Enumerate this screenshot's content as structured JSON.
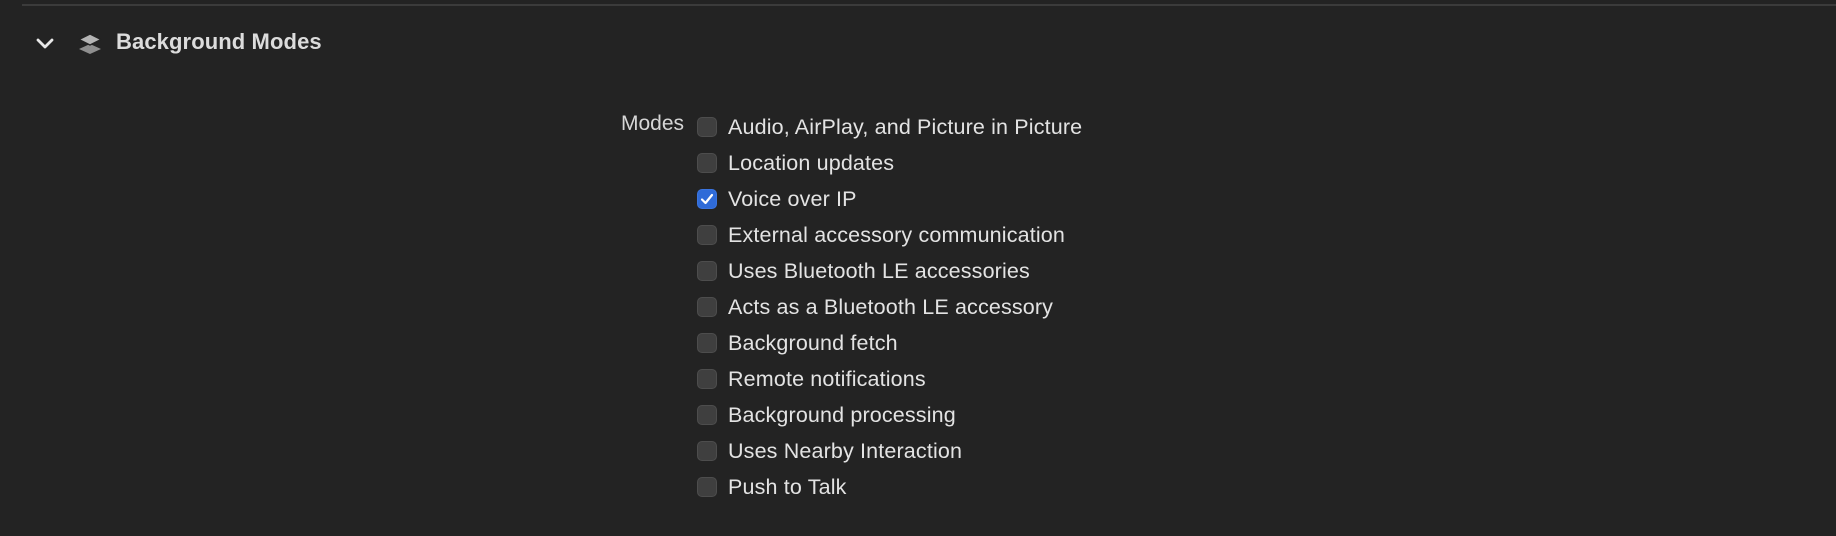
{
  "section": {
    "title": "Background Modes",
    "expanded": true,
    "disclosure_icon": "chevron-down-icon",
    "capability_icon": "layers-icon"
  },
  "modes": {
    "label": "Modes",
    "items": [
      {
        "label": "Audio, AirPlay, and Picture in Picture",
        "checked": false
      },
      {
        "label": "Location updates",
        "checked": false
      },
      {
        "label": "Voice over IP",
        "checked": true
      },
      {
        "label": "External accessory communication",
        "checked": false
      },
      {
        "label": "Uses Bluetooth LE accessories",
        "checked": false
      },
      {
        "label": "Acts as a Bluetooth LE accessory",
        "checked": false
      },
      {
        "label": "Background fetch",
        "checked": false
      },
      {
        "label": "Remote notifications",
        "checked": false
      },
      {
        "label": "Background processing",
        "checked": false
      },
      {
        "label": "Uses Nearby Interaction",
        "checked": false
      },
      {
        "label": "Push to Talk",
        "checked": false
      }
    ]
  },
  "colors": {
    "background": "#232323",
    "checkbox_checked": "#2f6bd8",
    "checkbox_unchecked": "#3f3f3f",
    "text": "#e3e3e3"
  }
}
